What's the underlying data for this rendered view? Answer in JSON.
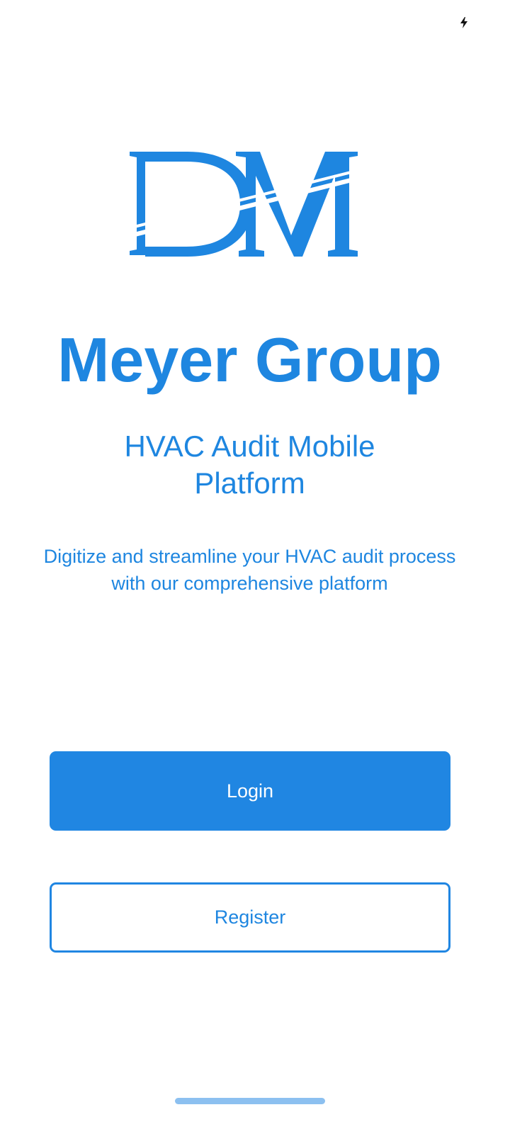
{
  "status_bar": {
    "charging_icon": "lightning-bolt-icon"
  },
  "logo": {
    "letters": "DM",
    "color": "#1e86e0"
  },
  "brand": {
    "title": "Meyer Group",
    "subtitle": "HVAC Audit Mobile Platform",
    "description": "Digitize and streamline your HVAC audit process with our comprehensive platform"
  },
  "actions": {
    "login_label": "Login",
    "register_label": "Register"
  },
  "colors": {
    "primary": "#2086e2",
    "background": "#ffffff",
    "on_primary": "#ffffff"
  }
}
